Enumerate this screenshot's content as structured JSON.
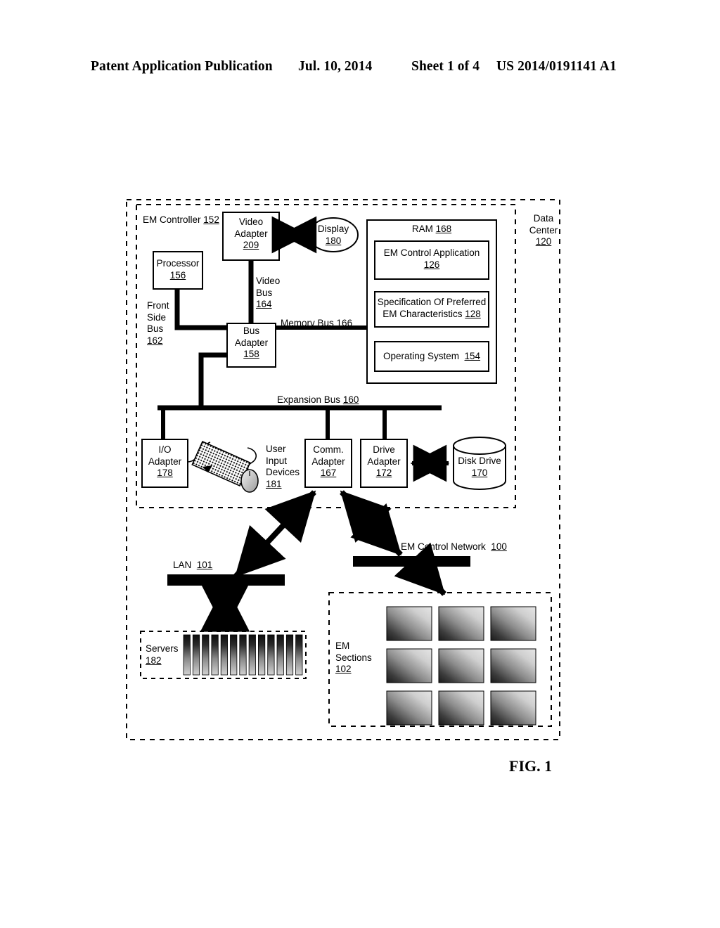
{
  "header": {
    "publication": "Patent Application Publication",
    "date": "Jul. 10, 2014",
    "sheet": "Sheet 1 of 4",
    "number": "US 2014/0191141 A1"
  },
  "figure": {
    "caption": "FIG. 1"
  },
  "diagram": {
    "data_center": {
      "line1": "Data",
      "line2": "Center",
      "ref": "120"
    },
    "em_controller": {
      "label": "EM Controller",
      "ref": "152"
    },
    "processor": {
      "label": "Processor",
      "ref": "156"
    },
    "front_side_bus": {
      "line1": "Front",
      "line2": "Side",
      "line3": "Bus",
      "ref": "162"
    },
    "video_adapter": {
      "line1": "Video",
      "line2": "Adapter",
      "ref": "209"
    },
    "display": {
      "label": "Display",
      "ref": "180"
    },
    "video_bus": {
      "line1": "Video",
      "line2": "Bus",
      "ref": "164"
    },
    "bus_adapter": {
      "line1": "Bus",
      "line2": "Adapter",
      "ref": "158"
    },
    "memory_bus": {
      "label": "Memory Bus",
      "ref": "166"
    },
    "ram": {
      "label": "RAM",
      "ref": "168"
    },
    "em_control_application": {
      "label": "EM Control Application",
      "ref": "126"
    },
    "specification": {
      "line1": "Specification Of Preferred",
      "line2": "EM Characteristics",
      "ref": "128"
    },
    "operating_system": {
      "label": "Operating System",
      "ref": "154"
    },
    "expansion_bus": {
      "label": "Expansion Bus",
      "ref": "160"
    },
    "io_adapter": {
      "line1": "I/O",
      "line2": "Adapter",
      "ref": "178"
    },
    "user_input_devices": {
      "line1": "User",
      "line2": "Input",
      "line3": "Devices",
      "ref": "181"
    },
    "comm_adapter": {
      "line1": "Comm.",
      "line2": "Adapter",
      "ref": "167"
    },
    "drive_adapter": {
      "line1": "Drive",
      "line2": "Adapter",
      "ref": "172"
    },
    "disk_drive": {
      "label": "Disk Drive",
      "ref": "170"
    },
    "lan": {
      "label": "LAN",
      "ref": "101"
    },
    "em_control_network": {
      "label": "EM Control Network",
      "ref": "100"
    },
    "servers": {
      "label": "Servers",
      "ref": "182",
      "rack_count": 13
    },
    "em_sections": {
      "line1": "EM",
      "line2": "Sections",
      "ref": "102",
      "tile_count": 9
    }
  },
  "colors": {
    "ink": "#000000",
    "paper": "#ffffff"
  }
}
